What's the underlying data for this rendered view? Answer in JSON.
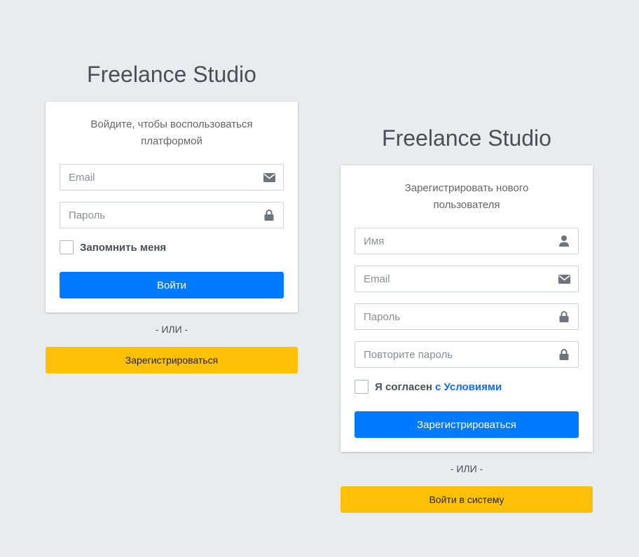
{
  "colors": {
    "background": "#e9ecef",
    "primary": "#007bff",
    "warning": "#ffc107",
    "link": "#0d6efd"
  },
  "login": {
    "brand": "Freelance Studio",
    "message": "Войдите, чтобы воспользоваться платформой",
    "email_placeholder": "Email",
    "email_icon": "envelope-icon",
    "password_placeholder": "Пароль",
    "password_icon": "lock-icon",
    "remember_label": "Запомнить меня",
    "remember_checked": false,
    "submit_label": "Войти",
    "or_text": "- ИЛИ -",
    "switch_label": "Зарегистрироваться"
  },
  "register": {
    "brand": "Freelance Studio",
    "message": "Зарегистрировать нового пользователя",
    "name_placeholder": "Имя",
    "name_icon": "user-icon",
    "email_placeholder": "Email",
    "email_icon": "envelope-icon",
    "password_placeholder": "Пароль",
    "password_icon": "lock-icon",
    "password_repeat_placeholder": "Повторите пароль",
    "password_repeat_icon": "lock-icon",
    "agree_label": "Я согласен",
    "agree_link": "с Условиями",
    "agree_checked": false,
    "submit_label": "Зарегистрироваться",
    "or_text": "- ИЛИ -",
    "switch_label": "Войти в систему"
  }
}
